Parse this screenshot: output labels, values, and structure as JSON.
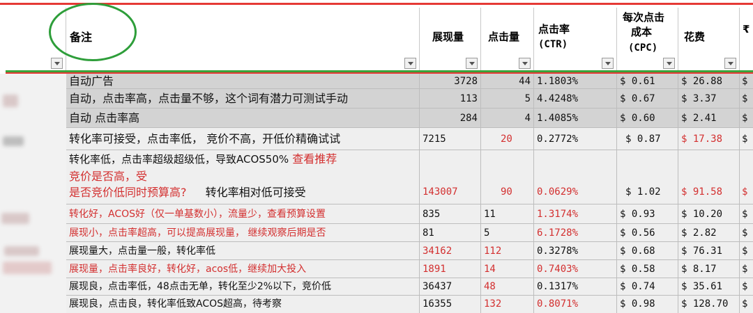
{
  "headers": {
    "note": "备注",
    "impressions": "展现量",
    "clicks": "点击量",
    "ctr": [
      "点击率",
      "(CTR)"
    ],
    "cpc": [
      "每次点击",
      "成本",
      "(CPC)"
    ],
    "cost": "花费",
    "extra": "₹"
  },
  "currency_symbol": "$",
  "row1": {
    "note": "自动广告",
    "impressions": "3728",
    "clicks": "44",
    "ctr": "1.1803%",
    "cpc": "$ 0.61",
    "cost": "$ 26.88",
    "extra": "$"
  },
  "row2": {
    "note": "自动，点击率高，点击量不够，这个词有潜力可测试手动",
    "impressions": "113",
    "clicks": "5",
    "ctr": "4.4248%",
    "cpc": "$ 0.67",
    "cost": "$ 3.37",
    "extra": "$"
  },
  "row3": {
    "note": "自动 点击率高",
    "impressions": "284",
    "clicks": "4",
    "ctr": "1.4085%",
    "cpc": "$ 0.60",
    "cost": "$ 2.41",
    "extra": "$"
  },
  "row4": {
    "note": "转化率可接受，点击率低， 竞价不高，开低价精确试试",
    "impressions": "7215",
    "clicks": "20",
    "ctr": "0.2772%",
    "cpc": "$ 0.87",
    "cost": "$ 17.38",
    "extra": "$"
  },
  "row5": {
    "note_line1_black": "转化率低，点击率超级超级低，导致ACOS50%",
    "note_line1_red": "查看推荐",
    "note_line2_red": "竞价是否高，受",
    "note_line3_red": "是否竞价低同时预算高?",
    "note_line3_black": "转化率相对低可接受",
    "impressions": "143007",
    "clicks": "90",
    "ctr": "0.0629%",
    "cpc": "$ 1.02",
    "cost": "$ 91.58",
    "extra": "$"
  },
  "row6": {
    "note": "转化好，ACOS好（仅一单基数小），流量少，查看预算设置",
    "impressions": "835",
    "clicks": "11",
    "ctr": "1.3174%",
    "cpc": "$ 0.93",
    "cost": "$ 10.20",
    "extra": "$"
  },
  "row7": {
    "note": "展现小，点击率超高，可以提高展现量， 继续观察后期是否",
    "impressions": "81",
    "clicks": "5",
    "ctr": "6.1728%",
    "cpc": "$ 0.56",
    "cost": "$ 2.82",
    "extra": "$"
  },
  "row8": {
    "note": "展现量大，点击量一般，转化率低",
    "impressions": "34162",
    "clicks": "112",
    "ctr": "0.3278%",
    "cpc": "$ 0.68",
    "cost": "$ 76.31",
    "extra": "$"
  },
  "row9": {
    "note": "展现量，点击率良好，转化好，acos低，继续加大投入",
    "impressions": "1891",
    "clicks": "14",
    "ctr": "0.7403%",
    "cpc": "$ 0.58",
    "cost": "$ 8.17",
    "extra": "$"
  },
  "row10": {
    "note": "展现良，点击率低，48点击无单，转化至少2%以下，竞价低",
    "impressions": "36437",
    "clicks": "48",
    "ctr": "0.1317%",
    "cpc": "$ 0.74",
    "cost": "$ 35.61",
    "extra": "$"
  },
  "row11": {
    "note": "展现良，点击良，转化率低致ACOS超高，待考察",
    "impressions": "16355",
    "clicks": "132",
    "ctr": "0.8071%",
    "cpc": "$ 0.98",
    "cost": "$ 128.70",
    "extra": "$"
  },
  "colors": {
    "red_text": "#d32f2f",
    "row_gray": "#d3d3d3",
    "annotation_green": "#2e9e3a",
    "annotation_red": "#e53935"
  }
}
